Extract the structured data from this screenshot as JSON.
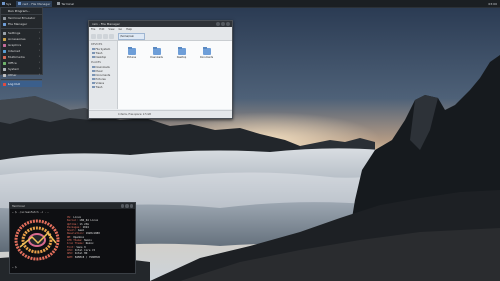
{
  "taskbar": {
    "items": [
      {
        "label": "Sys"
      },
      {
        "label": "cwd - File Manager"
      },
      {
        "label": "Terminal"
      }
    ],
    "clock": "03:00"
  },
  "menu": {
    "title": "Run Program...",
    "items": [
      {
        "label": "Terminal Emulator",
        "icon": "terminal-icon",
        "color": "#8e959c"
      },
      {
        "label": "File Manager",
        "icon": "folder-icon",
        "color": "#6e9ed8"
      },
      {
        "label": "Settings",
        "icon": "settings-icon",
        "color": "#9aa3ab",
        "submenu": true
      },
      {
        "label": "Accessories",
        "icon": "accessories-icon",
        "color": "#c9a24d",
        "submenu": true
      },
      {
        "label": "Graphics",
        "icon": "graphics-icon",
        "color": "#c46b9a",
        "submenu": true
      },
      {
        "label": "Internet",
        "icon": "internet-icon",
        "color": "#5a9fd6",
        "submenu": true
      },
      {
        "label": "Multimedia",
        "icon": "multimedia-icon",
        "color": "#d66b5a",
        "submenu": true
      },
      {
        "label": "Office",
        "icon": "office-icon",
        "color": "#6fb36b",
        "submenu": true
      },
      {
        "label": "System",
        "icon": "system-icon",
        "color": "#b0b6bc",
        "submenu": true
      },
      {
        "label": "Other",
        "icon": "other-icon",
        "color": "#c0c0c0",
        "submenu": true
      }
    ],
    "logout": {
      "label": "Log Out",
      "icon": "logout-icon",
      "color": "#e04b3f"
    }
  },
  "file_manager": {
    "title": "rain - File Manager",
    "menubar": [
      "File",
      "Edit",
      "View",
      "Go",
      "Help"
    ],
    "path": "/home/rain",
    "places_header": "DEVICES",
    "places": [
      "File System",
      "Trash",
      "Desktop"
    ],
    "places2_header": "PLACES",
    "places2": [
      "Downloads",
      "Music",
      "Documents",
      "Pictures",
      "Videos",
      "Trash"
    ],
    "items": [
      {
        "label": "Pictures"
      },
      {
        "label": "Downloads"
      },
      {
        "label": "Desktop"
      },
      {
        "label": "Documents"
      }
    ],
    "status": "4 items, Free space: 2.5 GB"
  },
  "terminal": {
    "title": "Terminal",
    "command": "~ $ ./screenfetch -c ...",
    "prompt": "~ $",
    "info": [
      {
        "k": "OS:",
        "v": "Linux"
      },
      {
        "k": "Kernel:",
        "v": "x86_64 Linux"
      },
      {
        "k": "Uptime:",
        "v": "1h 23m"
      },
      {
        "k": "Packages:",
        "v": "1024"
      },
      {
        "k": "Shell:",
        "v": "bash"
      },
      {
        "k": "Resolution:",
        "v": "1920x1080"
      },
      {
        "k": "WM:",
        "v": "Openbox"
      },
      {
        "k": "GTK Theme:",
        "v": "Numix"
      },
      {
        "k": "Icon Theme:",
        "v": "Numix"
      },
      {
        "k": "Font:",
        "v": "Sans 9"
      },
      {
        "k": "CPU:",
        "v": "Intel Core i5"
      },
      {
        "k": "GPU:",
        "v": "Intel HD"
      },
      {
        "k": "RAM:",
        "v": "845MiB / 7900MiB"
      }
    ]
  }
}
